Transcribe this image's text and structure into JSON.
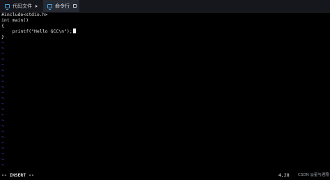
{
  "tabs": [
    {
      "label": "代码文件",
      "icon": "monitor-icon",
      "active": false
    },
    {
      "label": "命令行",
      "icon": "monitor-icon",
      "active": true
    }
  ],
  "editor": {
    "lines": [
      "#include<stdio.h>",
      "int main()",
      "{",
      "    printf(\"Hello GCC\\n\");",
      "}"
    ],
    "empty_marker": "~"
  },
  "status": {
    "mode": "-- INSERT --",
    "position": "4,28"
  },
  "watermark": "CSDN @星与酒隐",
  "colors": {
    "background": "#000000",
    "text": "#e6e6e6",
    "tilde": "#5a5aff",
    "tabbar": "#15171c",
    "active_tab": "#262a33",
    "accent": "#4aa3df"
  }
}
